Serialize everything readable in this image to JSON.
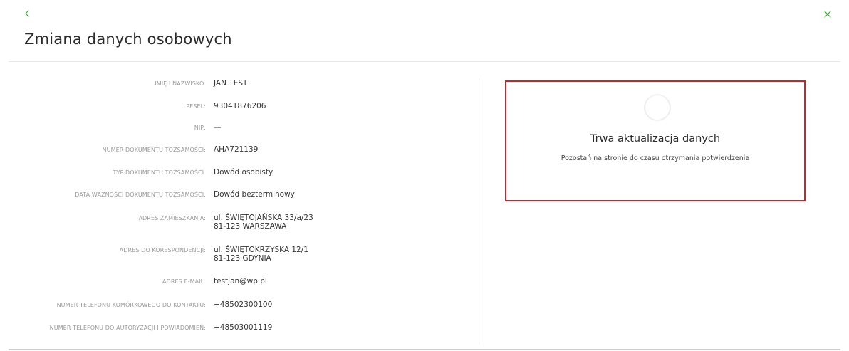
{
  "header": {
    "title": "Zmiana danych osobowych",
    "back_icon": "chevron-left-icon",
    "close_icon": "close-icon",
    "accent_color": "#3aa33a"
  },
  "details": {
    "name": {
      "label": "IMIĘ I NAZWISKO:",
      "value": "JAN TEST"
    },
    "pesel": {
      "label": "PESEL:",
      "value": "93041876206"
    },
    "nip": {
      "label": "NIP:",
      "value": "—"
    },
    "id_number": {
      "label": "NUMER DOKUMENTU TOŻSAMOŚCI:",
      "value": "AHA721139"
    },
    "id_type": {
      "label": "TYP DOKUMENTU TOŻSAMOŚCI:",
      "value": "Dowód osobisty"
    },
    "id_expiry": {
      "label": "DATA WAŻNOŚCI DOKUMENTU TOŻSAMOŚCI:",
      "value": "Dowód bezterminowy"
    },
    "address": {
      "label": "ADRES ZAMIESZKANIA:",
      "line1": "ul. ŚWIĘTOJAŃSKA 33/a/23",
      "line2": "81-123 WARSZAWA"
    },
    "correspondence": {
      "label": "ADRES DO KORESPONDENCJI:",
      "line1": "ul. ŚWIĘTOKRZYSKA 12/1",
      "line2": "81-123 GDYNIA"
    },
    "email": {
      "label": "ADRES E-MAIL:",
      "value": "testjan@wp.pl"
    },
    "mobile_contact": {
      "label": "NUMER TELEFONU KOMÓRKOWEGO DO KONTAKTU:",
      "value": "+48502300100"
    },
    "auth_phone": {
      "label": "NUMER TELEFONU DO AUTORYZACJI I POWIADOMIEŃ:",
      "value": "+48503001119"
    }
  },
  "status": {
    "title": "Trwa aktualizacja danych",
    "subtitle": "Pozostań na stronie do czasu otrzymania potwierdzenia",
    "border_color": "#c4262e",
    "icon": "loading-spinner-icon"
  }
}
